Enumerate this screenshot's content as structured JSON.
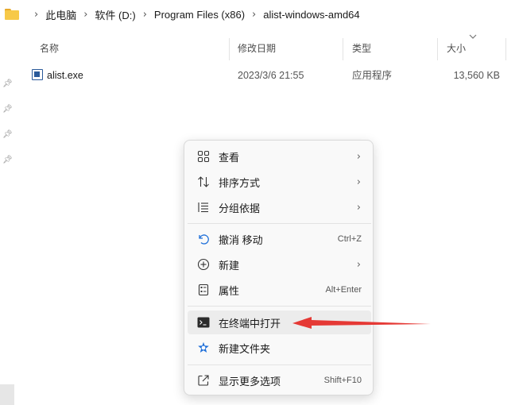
{
  "breadcrumb": {
    "items": [
      "此电脑",
      "软件 (D:)",
      "Program Files (x86)",
      "alist-windows-amd64"
    ]
  },
  "columns": {
    "name": "名称",
    "date": "修改日期",
    "type": "类型",
    "size": "大小"
  },
  "files": [
    {
      "name": "alist.exe",
      "date": "2023/3/6 21:55",
      "type": "应用程序",
      "size": "13,560 KB"
    }
  ],
  "context_menu": {
    "view": "查看",
    "sort": "排序方式",
    "group": "分组依据",
    "undo": "撤消 移动",
    "undo_shortcut": "Ctrl+Z",
    "new": "新建",
    "properties": "属性",
    "properties_shortcut": "Alt+Enter",
    "open_terminal": "在终端中打开",
    "new_folder": "新建文件夹",
    "more_options": "显示更多选项",
    "more_options_shortcut": "Shift+F10"
  },
  "colors": {
    "annotation_arrow": "#e53935",
    "folder_accent": "#f7c948",
    "new_folder_accent": "#1e6fd9"
  }
}
